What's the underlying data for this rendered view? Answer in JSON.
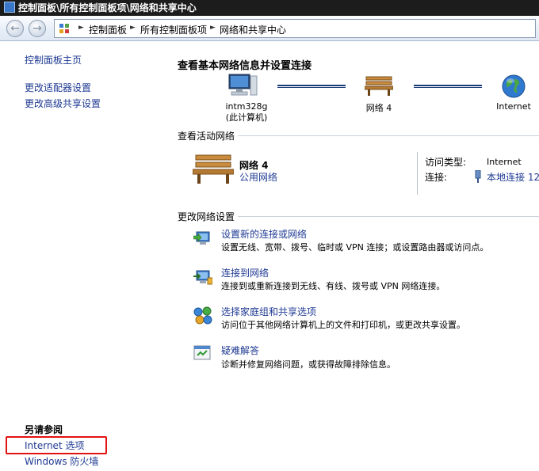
{
  "window": {
    "title": "控制面板\\所有控制面板项\\网络和共享中心"
  },
  "address_bar": {
    "crumbs": [
      "控制面板",
      "所有控制面板项",
      "网络和共享中心"
    ]
  },
  "sidebar": {
    "links": [
      "控制面板主页",
      "更改适配器设置",
      "更改高级共享设置"
    ],
    "see_also_title": "另请参阅",
    "see_also_links": [
      "Internet 选项",
      "Windows 防火墙"
    ]
  },
  "map": {
    "title": "查看基本网络信息并设置连接",
    "computer": {
      "name": "intm328g",
      "note": "(此计算机)"
    },
    "network": "网络  4",
    "internet": "Internet"
  },
  "active_networks": {
    "title": "查看活动网络",
    "name": "网络  4",
    "type": "公用网络",
    "access_type_label": "访问类型:",
    "access_type_value": "Internet",
    "connection_label": "连接:",
    "connection_value": "本地连接 12"
  },
  "change_settings": {
    "title": "更改网络设置",
    "tasks": [
      {
        "link": "设置新的连接或网络",
        "desc": "设置无线、宽带、拨号、临时或 VPN 连接；或设置路由器或访问点。",
        "icon": "new-connection-icon"
      },
      {
        "link": "连接到网络",
        "desc": "连接到或重新连接到无线、有线、拨号或 VPN 网络连接。",
        "icon": "connect-network-icon"
      },
      {
        "link": "选择家庭组和共享选项",
        "desc": "访问位于其他网络计算机上的文件和打印机，或更改共享设置。",
        "icon": "homegroup-icon"
      },
      {
        "link": "疑难解答",
        "desc": "诊断并修复网络问题，或获得故障排除信息。",
        "icon": "troubleshoot-icon"
      }
    ]
  },
  "colors": {
    "link": "#1f3a93",
    "highlight_box": "#e11212"
  }
}
